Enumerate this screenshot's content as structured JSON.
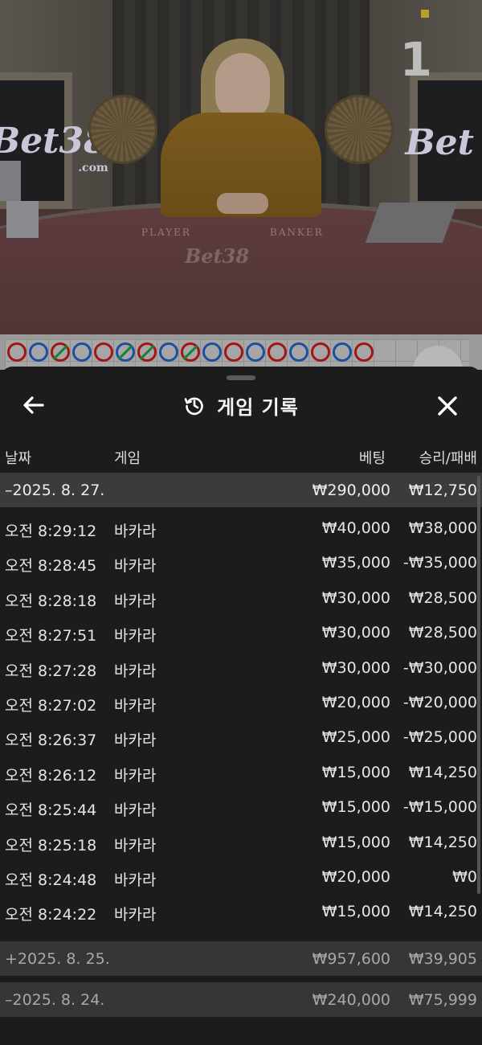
{
  "video": {
    "round_number": "1",
    "brand_left": "Bet38",
    "brand_left_sub": ".com",
    "brand_right": "Bet",
    "felt_player": "PLAYER",
    "felt_banker": "BANKER",
    "felt_brand": "Bet38"
  },
  "roadmap": {
    "beads": [
      "banker",
      "player",
      "banker-tie",
      "player",
      "banker",
      "player-tie",
      "banker-tie",
      "player",
      "banker-tie",
      "player",
      "banker",
      "player",
      "banker",
      "player",
      "banker",
      "player",
      "banker"
    ]
  },
  "sheet": {
    "title": "게임 기록",
    "columns": {
      "date": "날짜",
      "game": "게임",
      "bet": "베팅",
      "win_loss": "승리/패배"
    },
    "groups": [
      {
        "date": "–2025. 8. 27.",
        "bet": "₩290,000",
        "win_loss": "₩12,750",
        "expanded": true,
        "entries": [
          {
            "time": "오전 8:29:12",
            "game": "바카라",
            "bet": "₩40,000",
            "win_loss": "₩38,000"
          },
          {
            "time": "오전 8:28:45",
            "game": "바카라",
            "bet": "₩35,000",
            "win_loss": "-₩35,000"
          },
          {
            "time": "오전 8:28:18",
            "game": "바카라",
            "bet": "₩30,000",
            "win_loss": "₩28,500"
          },
          {
            "time": "오전 8:27:51",
            "game": "바카라",
            "bet": "₩30,000",
            "win_loss": "₩28,500"
          },
          {
            "time": "오전 8:27:28",
            "game": "바카라",
            "bet": "₩30,000",
            "win_loss": "-₩30,000"
          },
          {
            "time": "오전 8:27:02",
            "game": "바카라",
            "bet": "₩20,000",
            "win_loss": "-₩20,000"
          },
          {
            "time": "오전 8:26:37",
            "game": "바카라",
            "bet": "₩25,000",
            "win_loss": "-₩25,000"
          },
          {
            "time": "오전 8:26:12",
            "game": "바카라",
            "bet": "₩15,000",
            "win_loss": "₩14,250"
          },
          {
            "time": "오전 8:25:44",
            "game": "바카라",
            "bet": "₩15,000",
            "win_loss": "-₩15,000"
          },
          {
            "time": "오전 8:25:18",
            "game": "바카라",
            "bet": "₩15,000",
            "win_loss": "₩14,250"
          },
          {
            "time": "오전 8:24:48",
            "game": "바카라",
            "bet": "₩20,000",
            "win_loss": "₩0"
          },
          {
            "time": "오전 8:24:22",
            "game": "바카라",
            "bet": "₩15,000",
            "win_loss": "₩14,250"
          }
        ]
      },
      {
        "date": "+2025. 8. 25.",
        "bet": "₩957,600",
        "win_loss": "₩39,905",
        "expanded": false,
        "entries": []
      },
      {
        "date": "–2025. 8. 24.",
        "bet": "₩240,000",
        "win_loss": "₩75,999",
        "expanded": true,
        "entries": []
      }
    ]
  },
  "colors": {
    "sheet_bg": "#1c1c1c",
    "group_bg": "#3b3b3b",
    "text": "#e6e6e6",
    "banker_red": "#a31414",
    "player_blue": "#1d4fa0",
    "tie_green": "#15823a"
  },
  "icons": {
    "back": "arrow-left-icon",
    "close": "close-icon",
    "history": "history-icon"
  }
}
